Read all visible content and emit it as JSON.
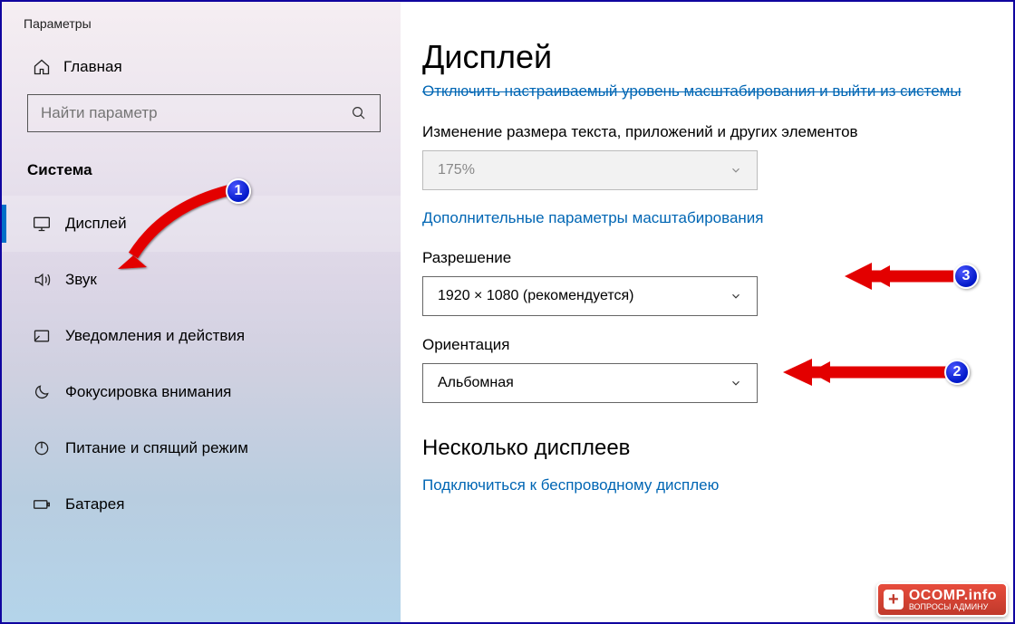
{
  "window": {
    "title": "Параметры"
  },
  "sidebar": {
    "home": "Главная",
    "search_placeholder": "Найти параметр",
    "section": "Система",
    "items": [
      {
        "label": "Дисплей",
        "icon": "display",
        "active": true
      },
      {
        "label": "Звук",
        "icon": "sound"
      },
      {
        "label": "Уведомления и действия",
        "icon": "notifications"
      },
      {
        "label": "Фокусировка внимания",
        "icon": "focus"
      },
      {
        "label": "Питание и спящий режим",
        "icon": "power"
      },
      {
        "label": "Батарея",
        "icon": "battery"
      }
    ]
  },
  "content": {
    "title": "Дисплей",
    "signout_link": "Отключить настраиваемый уровень масштабирования и выйти из системы",
    "scale_label": "Изменение размера текста, приложений и других элементов",
    "scale_value": "175%",
    "adv_scaling_link": "Дополнительные параметры масштабирования",
    "resolution_label": "Разрешение",
    "resolution_value": "1920 × 1080 (рекомендуется)",
    "orientation_label": "Ориентация",
    "orientation_value": "Альбомная",
    "multi_title": "Несколько дисплеев",
    "wireless_link": "Подключиться к беспроводному дисплею"
  },
  "annotations": {
    "b1": "1",
    "b2": "2",
    "b3": "3"
  },
  "watermark": {
    "line1": "OCOMP.info",
    "line2": "ВОПРОСЫ АДМИНУ"
  }
}
